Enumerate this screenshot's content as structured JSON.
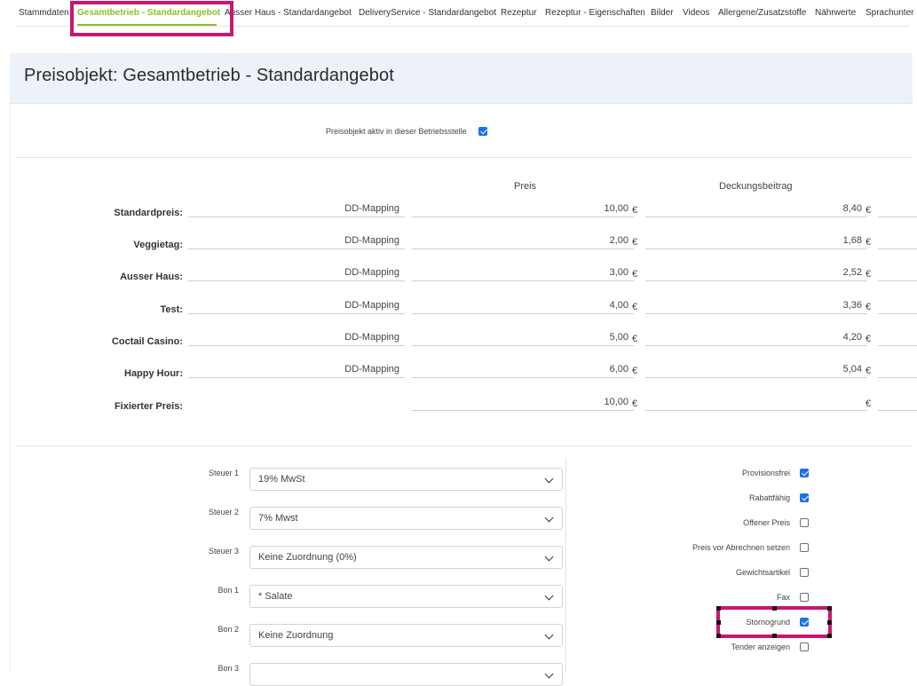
{
  "tabs": [
    {
      "label": "Stammdaten"
    },
    {
      "label": "Gesamtbetrieb - Standardangebot"
    },
    {
      "label": "Ausser Haus - Standardangebot"
    },
    {
      "label": "DeliveryService - Standardangebot"
    },
    {
      "label": "Rezeptur"
    },
    {
      "label": "Rezeptur - Eigenschaften"
    },
    {
      "label": "Bilder"
    },
    {
      "label": "Videos"
    },
    {
      "label": "Allergene/Zusatzstoffe"
    },
    {
      "label": "Nährwerte"
    },
    {
      "label": "Sprachunter"
    }
  ],
  "active_tab": "Gesamtbetrieb - Standardangebot",
  "accent_color": "#8dbf2a",
  "highlight_color": "#c8176e",
  "title": "Preisobjekt: Gesamtbetrieb - Standardangebot",
  "active_label": "Preisobjekt aktiv in dieser Betriebsstelle",
  "active_checked": true,
  "columns": {
    "preis": "Preis",
    "deckung": "Deckungsbeitrag"
  },
  "currency": "€",
  "rows": [
    {
      "label": "Standardpreis:",
      "mapping": "DD-Mapping",
      "preis": "10,00",
      "deckung": "8,40"
    },
    {
      "label": "Veggietag:",
      "mapping": "DD-Mapping",
      "preis": "2,00",
      "deckung": "1,68"
    },
    {
      "label": "Ausser Haus:",
      "mapping": "DD-Mapping",
      "preis": "3,00",
      "deckung": "2,52"
    },
    {
      "label": "Test:",
      "mapping": "DD-Mapping",
      "preis": "4,00",
      "deckung": "3,36"
    },
    {
      "label": "Coctail Casino:",
      "mapping": "DD-Mapping",
      "preis": "5,00",
      "deckung": "4,20"
    },
    {
      "label": "Happy Hour:",
      "mapping": "DD-Mapping",
      "preis": "6,00",
      "deckung": "5,04"
    },
    {
      "label": "Fixierter Preis:",
      "mapping": "",
      "preis": "10,00",
      "deckung": ""
    }
  ],
  "selects": [
    {
      "label": "Steuer 1",
      "value": "19% MwSt"
    },
    {
      "label": "Steuer 2",
      "value": "7% Mwst"
    },
    {
      "label": "Steuer 3",
      "value": "Keine Zuordnung (0%)"
    },
    {
      "label": "Bon 1",
      "value": "* Salate"
    },
    {
      "label": "Bon 2",
      "value": "Keine Zuordnung"
    },
    {
      "label": "Bon 3",
      "value": ""
    }
  ],
  "options": [
    {
      "label": "Provisionsfrei",
      "checked": true
    },
    {
      "label": "Rabattfähig",
      "checked": true
    },
    {
      "label": "Offener Preis",
      "checked": false
    },
    {
      "label": "Preis vor Abrechnen setzen",
      "checked": false
    },
    {
      "label": "Gewichtsartikel",
      "checked": false
    },
    {
      "label": "Fax",
      "checked": false
    },
    {
      "label": "Stornogrund",
      "checked": true
    },
    {
      "label": "Tender anzeigen",
      "checked": false
    }
  ]
}
